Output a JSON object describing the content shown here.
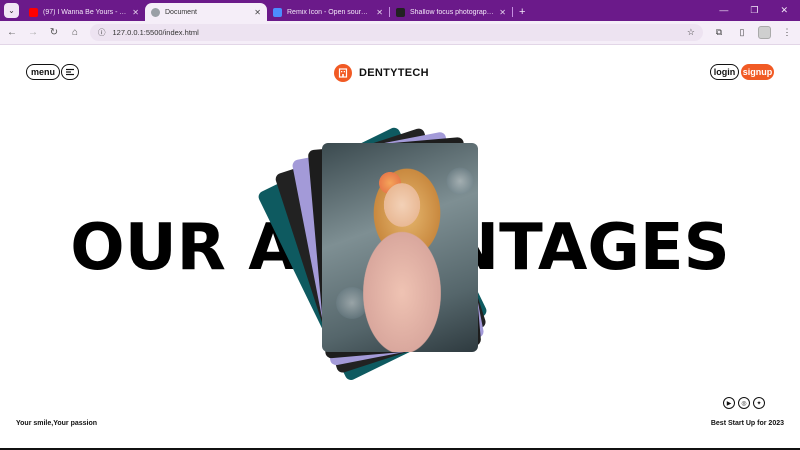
{
  "browser": {
    "tabs": [
      {
        "title": "(97) I Wanna Be Yours - YouTube",
        "favicon_color": "#ff0000",
        "active": false
      },
      {
        "title": "Document",
        "favicon_color": "#9aa0a6",
        "active": true
      },
      {
        "title": "Remix Icon - Open source icon",
        "favicon_color": "#4c8dff",
        "active": false
      },
      {
        "title": "Shallow focus photography of",
        "favicon_color": "#222222",
        "active": false
      }
    ],
    "url": "127.0.0.1:5500/index.html"
  },
  "nav": {
    "menu_label": "menu",
    "menu_icon": "menu-icon",
    "brand_name": "DENTYTECH",
    "login_label": "login",
    "signup_label": "signup"
  },
  "hero": {
    "headline": "OUR ADVANTAGES"
  },
  "footer": {
    "tagline": "Your smile,Your passion",
    "award": "Best Start Up for 2023",
    "social_icons": [
      "youtube-icon",
      "instagram-icon",
      "twitter-icon"
    ]
  },
  "colors": {
    "accent": "#f15a24",
    "tab_bar": "#6b1a8a"
  }
}
